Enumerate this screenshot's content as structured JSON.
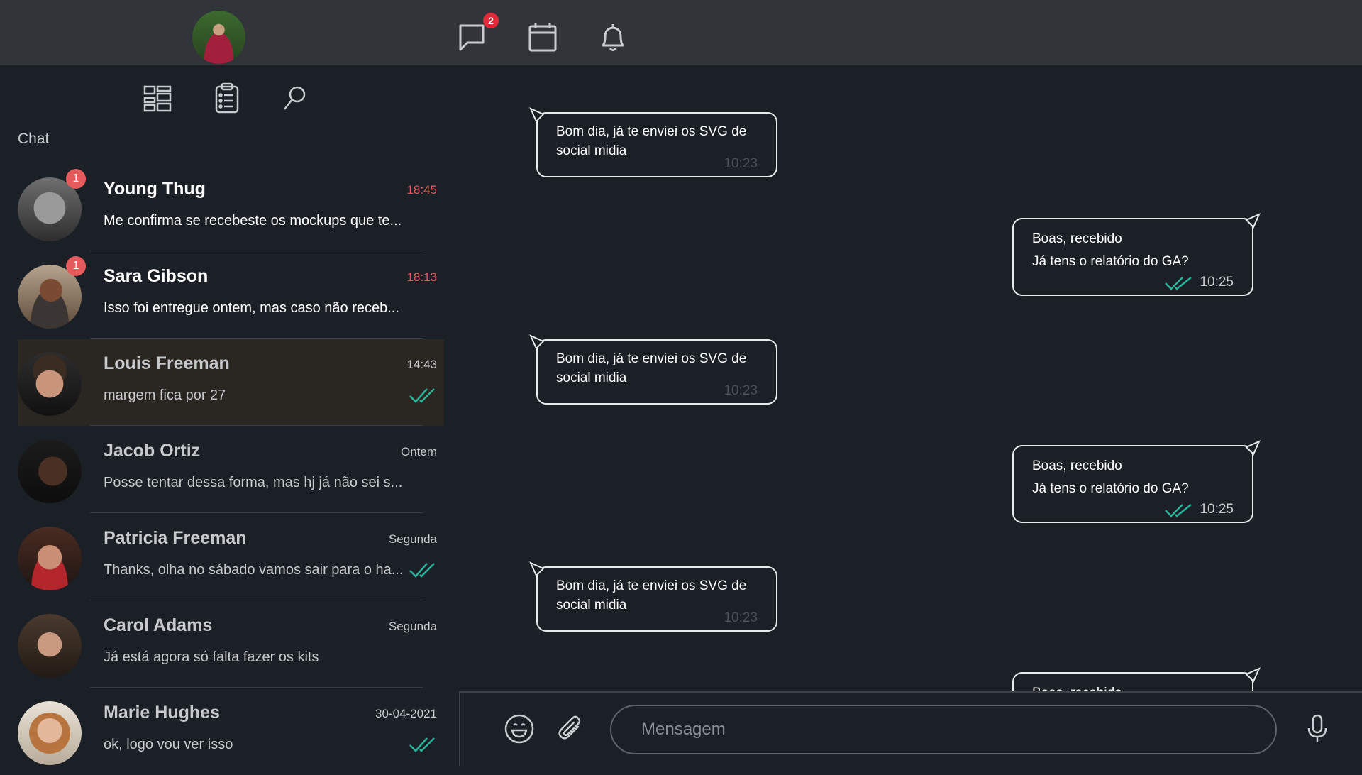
{
  "topbar": {
    "notification_badge": "2",
    "icons": [
      "chat-bubble-icon",
      "calendar-icon",
      "bell-icon"
    ]
  },
  "sidebar": {
    "heading": "Chat",
    "tools": [
      "layout-grid-icon",
      "clipboard-list-icon",
      "search-icon"
    ],
    "contacts": [
      {
        "name": "Young Thug",
        "time": "18:45",
        "preview": "Me confirma se recebeste os mockups que te...",
        "unread": "1",
        "read_ticks": false
      },
      {
        "name": "Sara Gibson",
        "time": "18:13",
        "preview": "Isso foi entregue ontem, mas caso não receb...",
        "unread": "1",
        "read_ticks": false
      },
      {
        "name": "Louis Freeman",
        "time": "14:43",
        "preview": "margem fica por 27",
        "unread": "",
        "read_ticks": true
      },
      {
        "name": "Jacob Ortiz",
        "time": "Ontem",
        "preview": "Posse tentar dessa forma, mas hj já não sei s...",
        "unread": "",
        "read_ticks": false
      },
      {
        "name": "Patricia Freeman",
        "time": "Segunda",
        "preview": "Thanks, olha no sábado vamos sair para o ha...",
        "unread": "",
        "read_ticks": true
      },
      {
        "name": "Carol Adams",
        "time": "Segunda",
        "preview": "Já está agora só falta fazer os kits",
        "unread": "",
        "read_ticks": false
      },
      {
        "name": "Marie Hughes",
        "time": "30-04-2021",
        "preview": "ok, logo vou ver isso",
        "unread": "",
        "read_ticks": true
      }
    ]
  },
  "messages": [
    {
      "direction": "in",
      "line1": "Bom dia, já te enviei os SVG de",
      "line2": "social midia",
      "time": "10:23"
    },
    {
      "direction": "out",
      "line1": "Boas, recebido",
      "line2": "Já tens o relatório do GA?",
      "time": "10:25"
    },
    {
      "direction": "in",
      "line1": "Bom dia, já te enviei os SVG de",
      "line2": "social midia",
      "time": "10:23"
    },
    {
      "direction": "out",
      "line1": "Boas, recebido",
      "line2": "Já tens o relatório do GA?",
      "time": "10:25"
    },
    {
      "direction": "in",
      "line1": "Bom dia, já te enviei os SVG de",
      "line2": "social midia",
      "time": "10:23"
    },
    {
      "direction": "out",
      "line1": "Boas, recebido",
      "line2": "",
      "time": ""
    }
  ],
  "composer": {
    "placeholder": "Mensagem",
    "icons": [
      "emoji-icon",
      "paperclip-icon",
      "microphone-icon"
    ]
  },
  "colors": {
    "background": "#1b2027",
    "topbar": "#31353a",
    "unread_accent": "#e5595a",
    "tick_green": "#2bb39a"
  }
}
